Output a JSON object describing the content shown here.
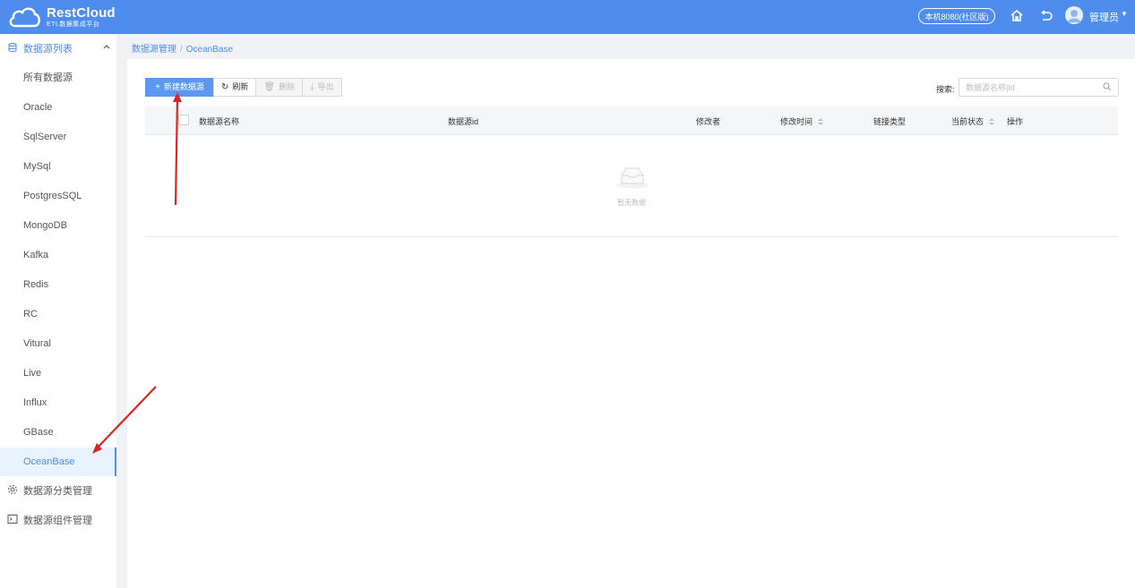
{
  "header": {
    "logo_name": "RestCloud",
    "logo_sub": "ETL数据集成平台",
    "env_badge": "本机8080(社区版)",
    "user_name": "管理员",
    "accent_color": "#4e8cee"
  },
  "sidebar": {
    "group_datasource_list": {
      "label": "数据源列表",
      "icon": "database-icon"
    },
    "items": [
      {
        "label": "所有数据源"
      },
      {
        "label": "Oracle"
      },
      {
        "label": "SqlServer"
      },
      {
        "label": "MySql"
      },
      {
        "label": "PostgresSQL"
      },
      {
        "label": "MongoDB"
      },
      {
        "label": "Kafka"
      },
      {
        "label": "Redis"
      },
      {
        "label": "RC"
      },
      {
        "label": "Vitural"
      },
      {
        "label": "Live"
      },
      {
        "label": "Influx"
      },
      {
        "label": "GBase"
      },
      {
        "label": "OceanBase"
      }
    ],
    "active_item": "OceanBase",
    "group_category": {
      "label": "数据源分类管理",
      "icon": "settings-icon"
    },
    "group_component": {
      "label": "数据源组件管理",
      "icon": "terminal-icon"
    }
  },
  "breadcrumb": {
    "root": "数据源管理",
    "current": "OceanBase"
  },
  "toolbar": {
    "new_label": "新建数据源",
    "refresh_label": "刷新",
    "delete_label": "删除",
    "export_label": "导出"
  },
  "search": {
    "label": "搜索:",
    "placeholder": "数据源名称|Id"
  },
  "table": {
    "columns": {
      "name": "数据源名称",
      "id": "数据源id",
      "modifier": "修改者",
      "modified_time": "修改时间",
      "link_type": "链接类型",
      "status": "当前状态",
      "actions": "操作"
    },
    "empty_text": "暂无数据"
  }
}
